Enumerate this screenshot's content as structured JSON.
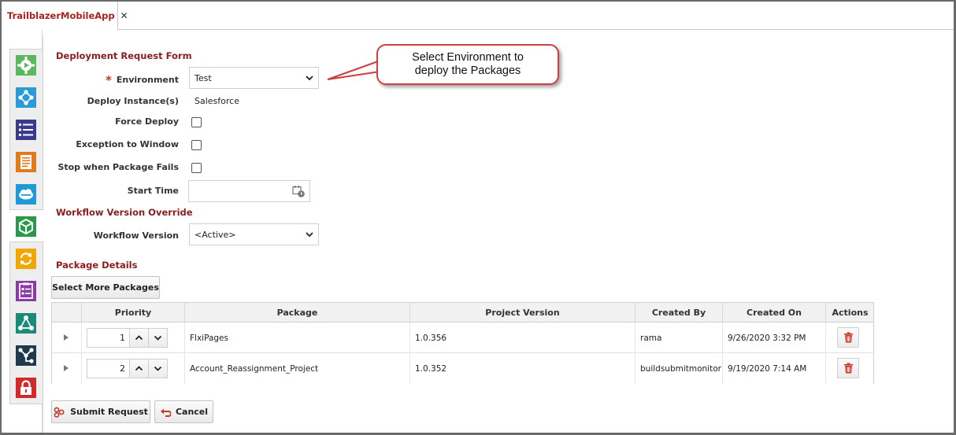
{
  "tab": {
    "title": "TrailblazerMobileApp",
    "close_icon": "close-icon"
  },
  "sidebar": {
    "items": [
      {
        "icon": "gear-play-icon",
        "color": "#5cb85c"
      },
      {
        "icon": "network-icon",
        "color": "#2a9bd6"
      },
      {
        "icon": "list-icon",
        "color": "#3a3a8c"
      },
      {
        "icon": "document-icon",
        "color": "#e07a1a"
      },
      {
        "icon": "salesforce-cloud-icon",
        "color": "#1f9ad6"
      },
      {
        "icon": "package-cube-icon",
        "color": "#2a9a4a"
      },
      {
        "icon": "refresh-icon",
        "color": "#f0a800"
      },
      {
        "icon": "checklist-icon",
        "color": "#8b3aa8"
      },
      {
        "icon": "share-nodes-icon",
        "color": "#1a8a7a"
      },
      {
        "icon": "pipeline-icon",
        "color": "#1f3a4a"
      },
      {
        "icon": "lock-icon",
        "color": "#d02a2a"
      }
    ]
  },
  "form": {
    "title": "Deployment Request Form",
    "required_mark": "*",
    "environment_label": "Environment",
    "environment_value": "Test",
    "deploy_instances_label": "Deploy Instance(s)",
    "deploy_instances_value": "Salesforce",
    "force_deploy_label": "Force Deploy",
    "exception_window_label": "Exception to Window",
    "stop_fail_label": "Stop when Package Fails",
    "start_time_label": "Start Time",
    "start_time_value": "",
    "workflow_section": "Workflow Version Override",
    "workflow_label": "Workflow Version",
    "workflow_value": "<Active>",
    "package_section": "Package Details",
    "select_more_label": "Select More Packages"
  },
  "table": {
    "headers": [
      "",
      "Priority",
      "Package",
      "Project Version",
      "Created By",
      "Created On",
      "Actions"
    ],
    "rows": [
      {
        "priority": "1",
        "package": "FlxiPages",
        "version": "1.0.356",
        "created_by": "rama",
        "created_on": "9/26/2020 3:32 PM"
      },
      {
        "priority": "2",
        "package": "Account_Reassignment_Project",
        "version": "1.0.352",
        "created_by": "buildsubmitmonitor",
        "created_on": "9/19/2020 7:14 AM"
      }
    ]
  },
  "actions": {
    "submit_label": "Submit Request",
    "cancel_label": "Cancel"
  },
  "callout": {
    "line1": "Select Environment to",
    "line2": "deploy the Packages"
  },
  "colors": {
    "brand_red": "#a8231d",
    "section_title": "#8b1d1d",
    "callout_border": "#c94040"
  }
}
